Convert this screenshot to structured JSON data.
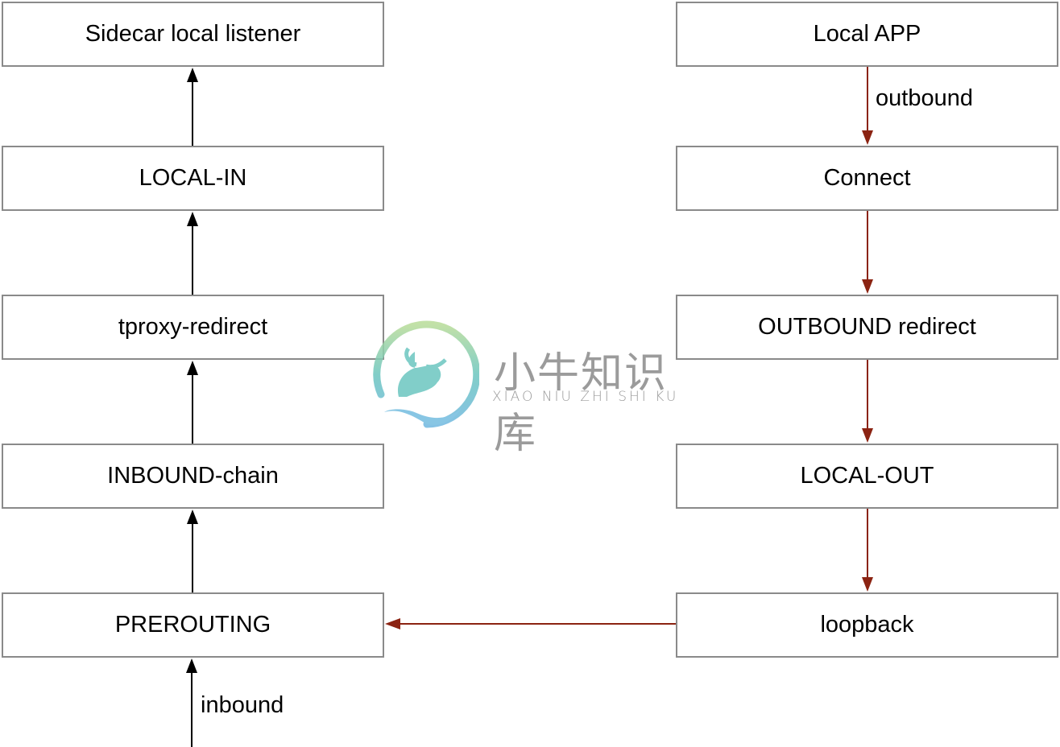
{
  "colors": {
    "inbound_arrow": "#000000",
    "outbound_arrow": "#8b2312",
    "box_border": "#8a8a8a"
  },
  "left_chain": {
    "boxes": [
      "Sidecar local listener",
      "LOCAL-IN",
      "tproxy-redirect",
      "INBOUND-chain",
      "PREROUTING"
    ],
    "entry_label": "inbound"
  },
  "right_chain": {
    "boxes": [
      "Local APP",
      "Connect",
      "OUTBOUND redirect",
      "LOCAL-OUT",
      "loopback"
    ],
    "entry_label": "outbound"
  },
  "watermark": {
    "cn": "小牛知识库",
    "en": "XIAO NIU ZHI SHI KU"
  }
}
